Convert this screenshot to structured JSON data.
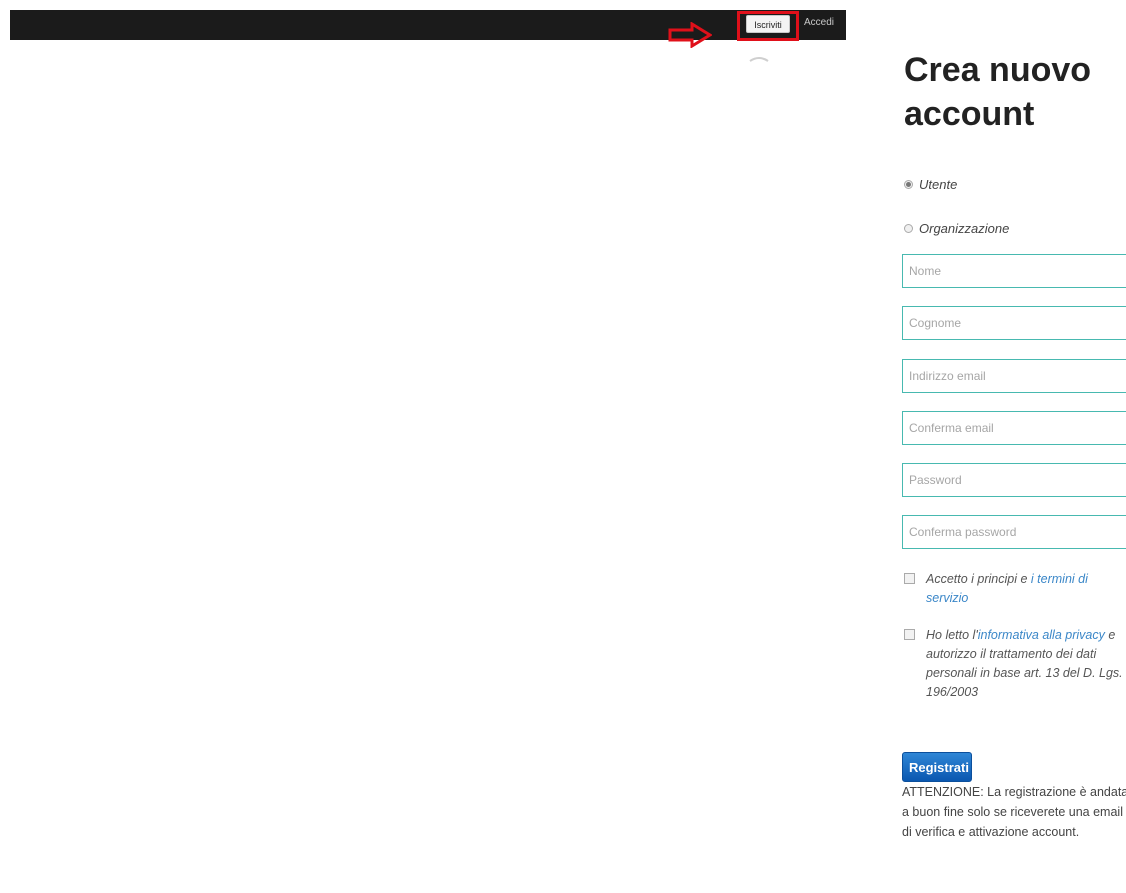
{
  "navbar": {
    "signup_label": "Iscriviti",
    "login_label": "Accedi"
  },
  "form": {
    "title": "Crea nuovo account",
    "account_types": [
      {
        "label": "Utente",
        "checked": true
      },
      {
        "label": "Organizzazione",
        "checked": false
      }
    ],
    "fields": {
      "nome": {
        "placeholder": "Nome",
        "value": ""
      },
      "cognome": {
        "placeholder": "Cognome",
        "value": ""
      },
      "email": {
        "placeholder": "Indirizzo email",
        "value": ""
      },
      "email_confirm": {
        "placeholder": "Conferma email",
        "value": ""
      },
      "password": {
        "placeholder": "Password",
        "value": ""
      },
      "password_confirm": {
        "placeholder": "Conferma password",
        "value": ""
      }
    },
    "terms": {
      "prefix": "Accetto i principi e ",
      "link": "i termini di servizio"
    },
    "privacy": {
      "prefix": "Ho letto l'",
      "link": "informativa alla privacy",
      "suffix": " e autorizzo il trattamento dei dati personali in base art. 13 del D. Lgs. 196/2003"
    },
    "submit_label": "Registrati",
    "notice": "ATTENZIONE: La registrazione è andata a buon fine solo se riceverete una email di verifica e attivazione account."
  },
  "colors": {
    "navbar_bg": "#1b1b1b",
    "highlight": "#e0101a",
    "field_border": "#48b9b0",
    "link": "#3b87c8",
    "submit_bg": "#0a57b0"
  }
}
